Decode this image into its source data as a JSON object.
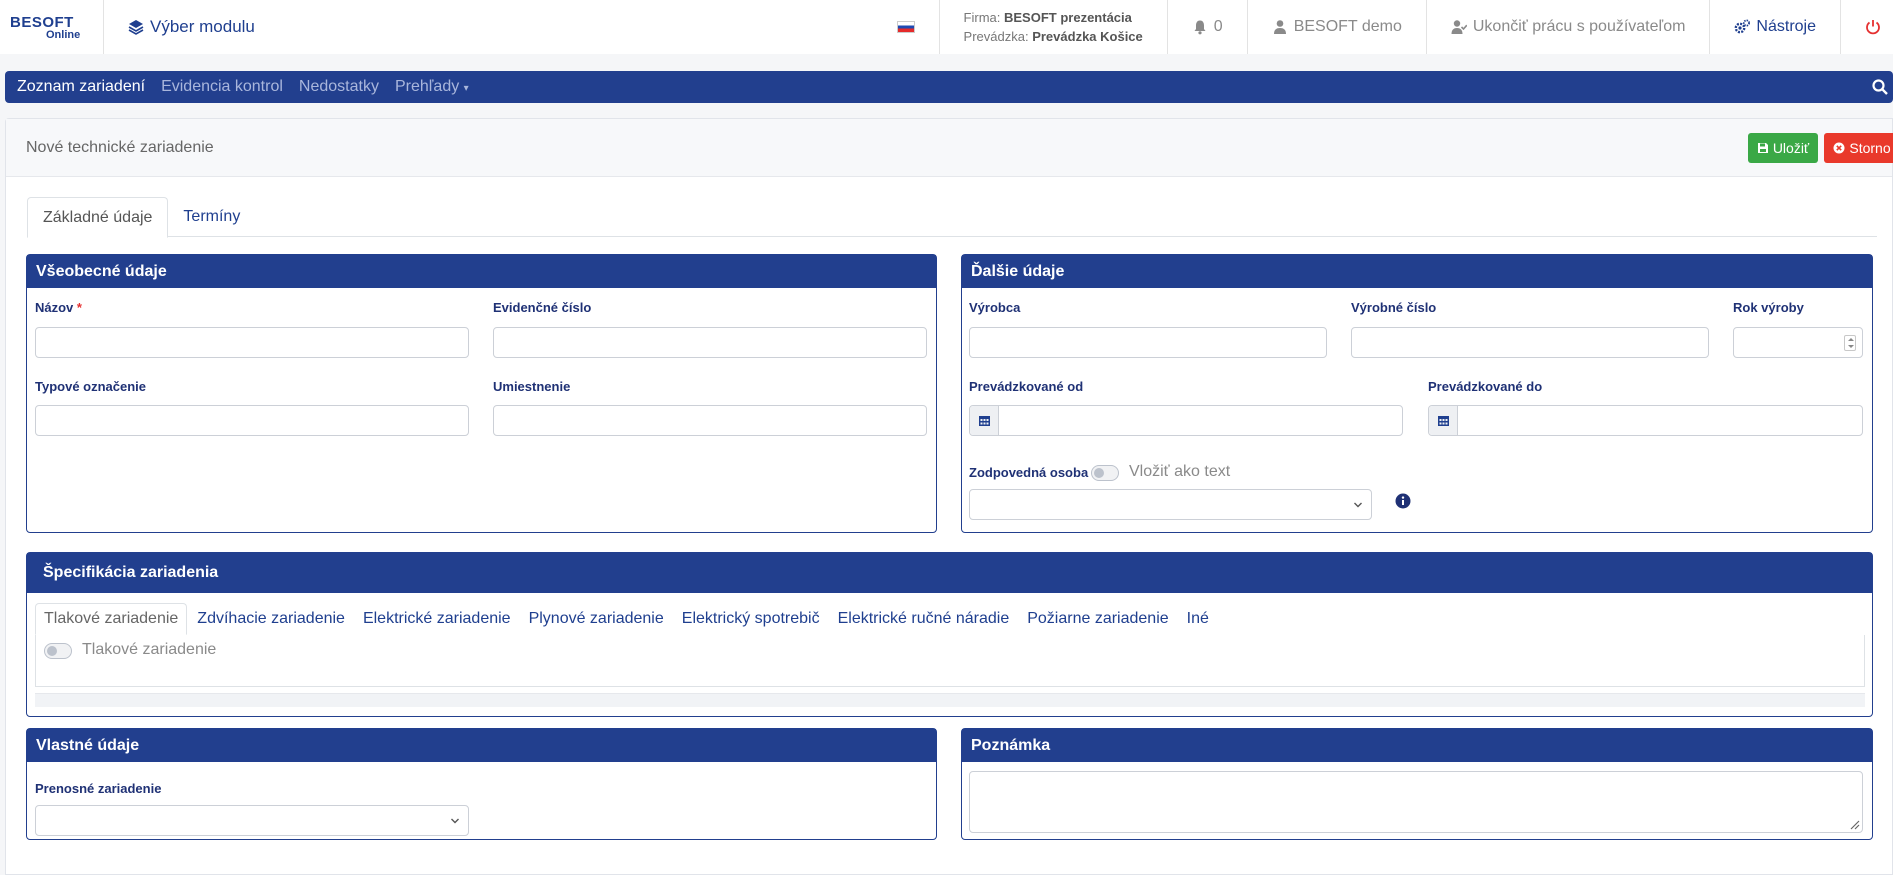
{
  "header": {
    "logo_top": "BESOFT",
    "logo_bottom": "Online",
    "module_selector": "Výber modulu",
    "language": "sk",
    "firm_label": "Firma:",
    "firm_value": "BESOFT prezentácia",
    "branch_label": "Prevádzka:",
    "branch_value": "Prevádzka Košice",
    "notifications_count": "0",
    "user": "BESOFT demo",
    "end_work": "Ukončiť prácu s používateľom",
    "tools": "Nástroje"
  },
  "nav": {
    "items": [
      "Zoznam zariadení",
      "Evidencia kontrol",
      "Nedostatky",
      "Prehľady"
    ]
  },
  "page": {
    "title": "Nové technické zariadenie",
    "save": "Uložiť",
    "cancel": "Storno",
    "tabs": [
      "Základné údaje",
      "Termíny"
    ]
  },
  "general": {
    "title": "Všeobecné údaje",
    "name_label": "Názov",
    "required_mark": "*",
    "evid_label": "Evidenčné číslo",
    "type_label": "Typové označenie",
    "location_label": "Umiestnenie"
  },
  "other": {
    "title": "Ďalšie údaje",
    "manufacturer_label": "Výrobca",
    "serial_label": "Výrobné číslo",
    "year_label": "Rok výroby",
    "operated_from_label": "Prevádzkované od",
    "operated_to_label": "Prevádzkované do",
    "responsible_label": "Zodpovedná osoba",
    "insert_as_text": "Vložiť ako text"
  },
  "spec": {
    "title": "Špecifikácia zariadenia",
    "tabs": [
      "Tlakové zariadenie",
      "Zdvíhacie zariadenie",
      "Elektrické zariadenie",
      "Plynové zariadenie",
      "Elektrický spotrebič",
      "Elektrické ručné náradie",
      "Požiarne zariadenie",
      "Iné"
    ],
    "toggle_label": "Tlakové zariadenie"
  },
  "custom": {
    "title": "Vlastné údaje",
    "portable_label": "Prenosné zariadenie"
  },
  "note": {
    "title": "Poznámka"
  },
  "colors": {
    "primary": "#223f8e",
    "save": "#3aa846",
    "cancel": "#e9392b"
  }
}
